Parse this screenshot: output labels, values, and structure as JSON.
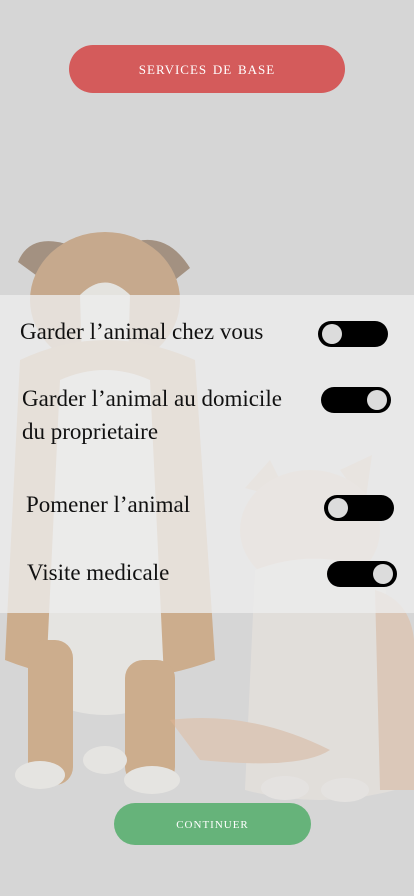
{
  "colors": {
    "header_button": "#d45b5b",
    "continue_button": "#66b37a",
    "toggle_track": "#000000"
  },
  "header": {
    "title": "SERVICES DE BASE"
  },
  "services": [
    {
      "label": "Garder l’animal chez vous",
      "enabled": false
    },
    {
      "label_line1": "Garder l’animal au domicile",
      "label_line2": "du proprietaire",
      "enabled": true
    },
    {
      "label": "Pomener l’animal",
      "enabled": false
    },
    {
      "label": "Visite medicale",
      "enabled": true
    }
  ],
  "footer": {
    "continue_label": "CONTINUER"
  }
}
